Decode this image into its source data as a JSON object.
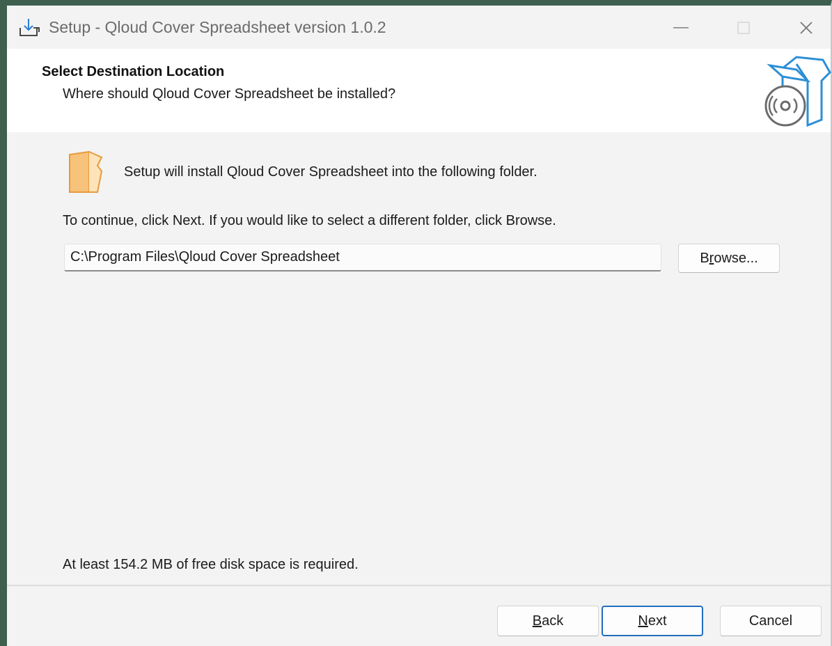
{
  "window": {
    "title": "Setup - Qloud Cover Spreadsheet version 1.0.2"
  },
  "header": {
    "title": "Select Destination Location",
    "subtitle": "Where should Qloud Cover Spreadsheet be installed?"
  },
  "content": {
    "intro": "Setup will install Qloud Cover Spreadsheet into the following folder.",
    "instruction": "To continue, click Next. If you would like to select a different folder, click Browse.",
    "install_path": "C:\\Program Files\\Qloud Cover Spreadsheet",
    "browse_label_pre": "B",
    "browse_label_key": "r",
    "browse_label_post": "owse...",
    "disk_space": "At least 154.2 MB of free disk space is required."
  },
  "footer": {
    "back_key": "B",
    "back_rest": "ack",
    "next_key": "N",
    "next_rest": "ext",
    "cancel_label": "Cancel"
  },
  "icons": {
    "app": "installer-download-icon",
    "header": "software-box-disc-icon",
    "folder": "folder-icon"
  },
  "colors": {
    "accent": "#1f6fbf",
    "folder": "#f3b25f",
    "box": "#2b8fd6"
  }
}
